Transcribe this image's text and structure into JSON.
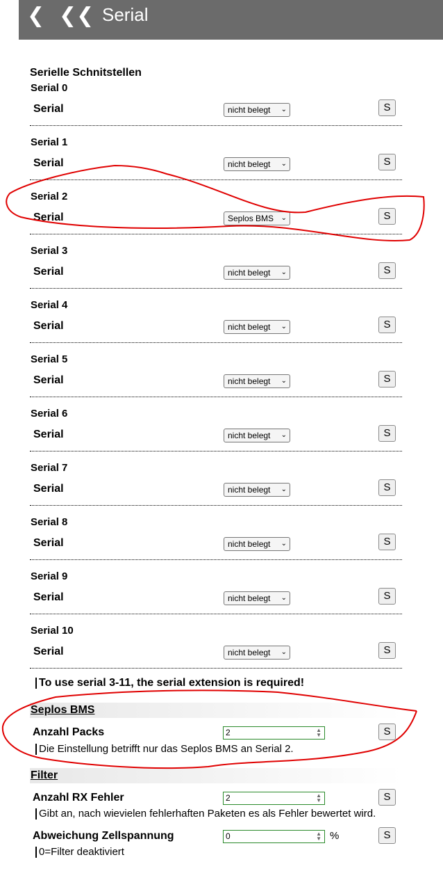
{
  "header": {
    "back_label": "❮",
    "back_home_label": "❮❮",
    "title": "Serial"
  },
  "section_title": "Serielle Schnitstellen",
  "serials": [
    {
      "name": "Serial 0",
      "label": "Serial",
      "value": "nicht belegt",
      "button": "S"
    },
    {
      "name": "Serial 1",
      "label": "Serial",
      "value": "nicht belegt",
      "button": "S"
    },
    {
      "name": "Serial 2",
      "label": "Serial",
      "value": "Seplos BMS",
      "button": "S"
    },
    {
      "name": "Serial 3",
      "label": "Serial",
      "value": "nicht belegt",
      "button": "S"
    },
    {
      "name": "Serial 4",
      "label": "Serial",
      "value": "nicht belegt",
      "button": "S"
    },
    {
      "name": "Serial 5",
      "label": "Serial",
      "value": "nicht belegt",
      "button": "S"
    },
    {
      "name": "Serial 6",
      "label": "Serial",
      "value": "nicht belegt",
      "button": "S"
    },
    {
      "name": "Serial 7",
      "label": "Serial",
      "value": "nicht belegt",
      "button": "S"
    },
    {
      "name": "Serial 8",
      "label": "Serial",
      "value": "nicht belegt",
      "button": "S"
    },
    {
      "name": "Serial 9",
      "label": "Serial",
      "value": "nicht belegt",
      "button": "S"
    },
    {
      "name": "Serial 10",
      "label": "Serial",
      "value": "nicht belegt",
      "button": "S"
    }
  ],
  "extension_note": "To use serial 3-11, the serial extension is required!",
  "seplos": {
    "group_title": "Seplos BMS",
    "packs_label": "Anzahl Packs",
    "packs_value": "2",
    "packs_button": "S",
    "packs_help": "Die Einstellung betrifft nur das Seplos BMS an Serial 2."
  },
  "filter": {
    "group_title": "Filter",
    "rx_label": "Anzahl RX Fehler",
    "rx_value": "2",
    "rx_button": "S",
    "rx_help": "Gibt an, nach wievielen fehlerhaften Paketen es als Fehler bewertet wird.",
    "cell_label": "Abweichung Zellspannung",
    "cell_value": "0",
    "cell_unit": "%",
    "cell_button": "S",
    "cell_help": "0=Filter deaktiviert"
  },
  "colors": {
    "header_bg": "#6b6b6b",
    "annotation": "#e00000",
    "number_border": "#2a8a2a"
  },
  "icons": {
    "select_arrow": "chevron-down-icon",
    "spinner": "spinner-arrows-icon"
  }
}
